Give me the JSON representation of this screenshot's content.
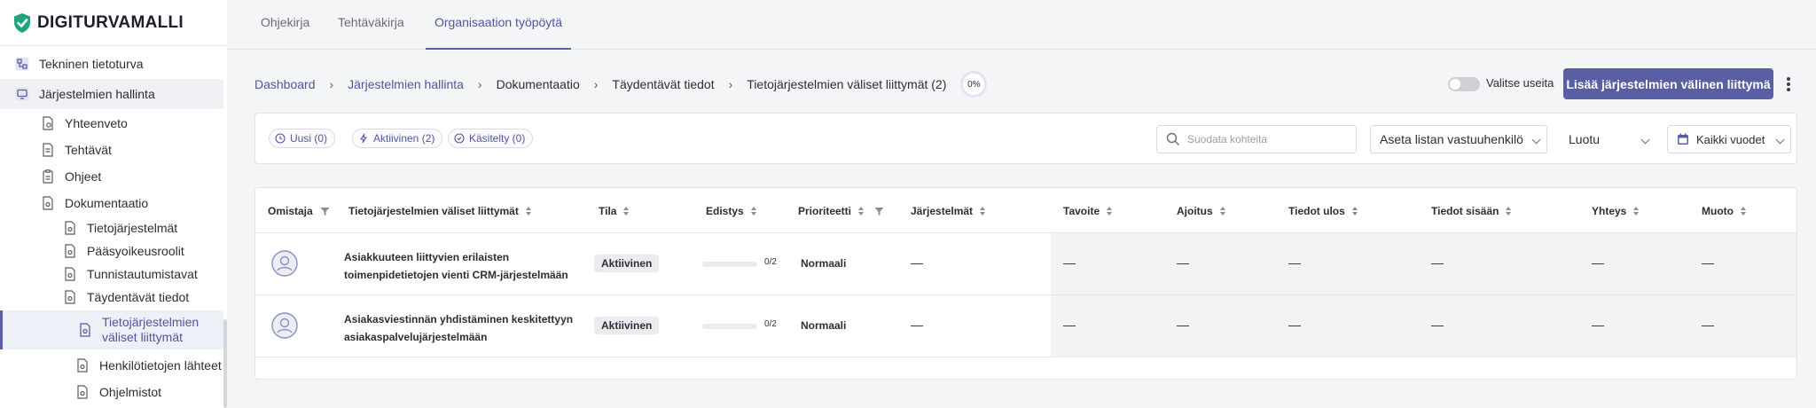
{
  "app": {
    "name": "DIGITURVAMALLI"
  },
  "topnav": {
    "tabs": [
      "Ohjekirja",
      "Tehtäväkirja",
      "Organisaation työpöytä"
    ],
    "active": 2
  },
  "sidebar": {
    "items": [
      {
        "label": "Tekninen tietoturva",
        "icon": "network-icon"
      },
      {
        "label": "Järjestelmien hallinta",
        "icon": "monitor-icon"
      },
      {
        "label": "Yhteenveto",
        "icon": "document-search-icon"
      },
      {
        "label": "Tehtävät",
        "icon": "document-list-icon"
      },
      {
        "label": "Ohjeet",
        "icon": "clipboard-icon"
      },
      {
        "label": "Dokumentaatio",
        "icon": "document-gear-icon"
      },
      {
        "label": "Tietojärjestelmät",
        "icon": "document-gear-icon"
      },
      {
        "label": "Pääsyoikeusroolit",
        "icon": "document-gear-icon"
      },
      {
        "label": "Tunnistautumistavat",
        "icon": "document-gear-icon"
      },
      {
        "label": "Täydentävät tiedot",
        "icon": "document-gear-icon"
      },
      {
        "label": "Tietojärjestelmien väliset liittymät",
        "icon": "document-gear-icon"
      },
      {
        "label": "Henkilötietojen lähteet",
        "icon": "document-gear-icon"
      },
      {
        "label": "Ohjelmistot",
        "icon": "document-gear-icon"
      }
    ]
  },
  "breadcrumb": {
    "items": [
      "Dashboard",
      "Järjestelmien hallinta",
      "Dokumentaatio",
      "Täydentävät tiedot",
      "Tietojärjestelmien väliset liittymät (2)"
    ],
    "progress": "0%"
  },
  "toolbar": {
    "multi_select_label": "Valitse useita",
    "add_button_label": "Lisää järjestelmien välinen liittymä"
  },
  "filters": {
    "chips": [
      {
        "label": "Uusi (0)",
        "icon": "clock-icon"
      },
      {
        "label": "Aktiivinen (2)",
        "icon": "bolt-icon"
      },
      {
        "label": "Käsitelty (0)",
        "icon": "check-circle-icon"
      }
    ],
    "search_placeholder": "Suodata kohteita",
    "owner_select": "Aseta listan vastuuhenkilö",
    "sort_select": "Luotu",
    "year_select": "Kaikki vuodet"
  },
  "table": {
    "columns": [
      "Omistaja",
      "Tietojärjestelmien väliset liittymät",
      "Tila",
      "Edistys",
      "Prioriteetti",
      "Järjestelmät",
      "Tavoite",
      "Ajoitus",
      "Tiedot ulos",
      "Tiedot sisään",
      "Yhteys",
      "Muoto"
    ],
    "rows": [
      {
        "name": "Asiakkuuteen liittyvien erilaisten toimenpidetietojen vienti CRM-järjestelmään",
        "status": "Aktiivinen",
        "progress_text": "0/2",
        "progress_fraction": 0,
        "priority": "Normaali",
        "systems": "—",
        "goal": "—",
        "timing": "—",
        "data_out": "—",
        "data_in": "—",
        "connection": "—",
        "format": "—"
      },
      {
        "name": "Asiakasviestinnän yhdistäminen keskitettyyn asiakaspalvelujärjestelmään",
        "status": "Aktiivinen",
        "progress_text": "0/2",
        "progress_fraction": 0,
        "priority": "Normaali",
        "systems": "—",
        "goal": "—",
        "timing": "—",
        "data_out": "—",
        "data_in": "—",
        "connection": "—",
        "format": "—"
      }
    ]
  },
  "colors": {
    "accent": "#5a5fa3",
    "logo": "#1fa37a",
    "background": "#f4f5f7"
  }
}
